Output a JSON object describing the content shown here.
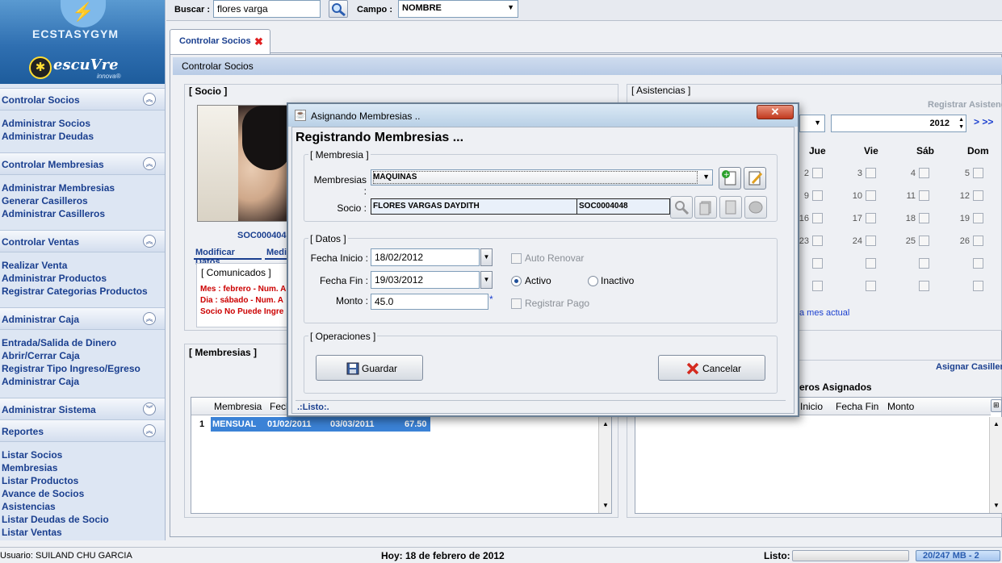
{
  "logo": {
    "brand_main": "ECSTASYGYM",
    "brand_sub": "escuVre",
    "brand_tag": "innova®"
  },
  "sidebar": {
    "sections": [
      {
        "title": "Controlar Socios",
        "collapsed": false,
        "items": [
          "Administrar Socios",
          "Administrar Deudas"
        ]
      },
      {
        "title": "Controlar Membresias",
        "collapsed": false,
        "items": [
          "Administrar Membresias",
          "Generar Casilleros",
          "Administrar Casilleros"
        ]
      },
      {
        "title": "Controlar Ventas",
        "collapsed": false,
        "items": [
          "Realizar Venta",
          "Administrar Productos",
          "Registrar Categorias Productos"
        ]
      },
      {
        "title": "Administrar Caja",
        "collapsed": false,
        "items": [
          "Entrada/Salida de Dinero",
          "Abrir/Cerrar Caja",
          "Registrar Tipo Ingreso/Egreso",
          "Administrar Caja"
        ]
      },
      {
        "title": "Administrar Sistema",
        "collapsed": true,
        "items": []
      },
      {
        "title": "Reportes",
        "collapsed": false,
        "items": [
          "Listar Socios",
          "Membresias",
          "Listar Productos",
          "Avance de Socios",
          "Asistencias",
          "Listar Deudas de Socio",
          "Listar Ventas"
        ]
      }
    ]
  },
  "search": {
    "label": "Buscar :",
    "value": "flores varga",
    "campo_label": "Campo :",
    "campo_value": "NOMBRE"
  },
  "tabs": [
    {
      "label": "Controlar Socios"
    }
  ],
  "breadcrumb": "Controlar Socios",
  "socio_panel": {
    "title": "[ Socio ]",
    "code_partial": "SOC000404",
    "btn_modificar": "Modificar Datos",
    "btn_medi": "Medi",
    "comunicados_title": "[ Comunicados ]",
    "comunicados": [
      "Mes : febrero - Num. A",
      "Dia : sábado - Num. A",
      "Socio No Puede Ingre"
    ]
  },
  "membresias_panel": {
    "title": "[ Membresias ]",
    "headers": [
      "Membresia",
      "Fech"
    ],
    "rows": [
      {
        "num": "1",
        "membresia": "MENSUAL",
        "inicio": "01/02/2011",
        "fin": "03/03/2011",
        "monto": "67.50"
      }
    ]
  },
  "asistencias_panel": {
    "title": "[ Asistencias ]",
    "registrar_label": "Registrar Asistenc",
    "year": "2012",
    "nav": "> >>",
    "days": [
      "Jue",
      "Vie",
      "Sáb",
      "Dom"
    ],
    "weeks": [
      [
        "2",
        "3",
        "4",
        "5"
      ],
      [
        "9",
        "10",
        "11",
        "12"
      ],
      [
        "16",
        "17",
        "18",
        "19"
      ],
      [
        "23",
        "24",
        "25",
        "26"
      ],
      [
        "",
        "",
        "",
        ""
      ],
      [
        "",
        "",
        "",
        ""
      ]
    ],
    "link": "a mes actual"
  },
  "casilleros_panel": {
    "asignar_label": "Asignar Casiller",
    "title": "eros Asignados",
    "headers": [
      "Inicio",
      "Fecha Fin",
      "Monto"
    ]
  },
  "dialog": {
    "window_title": "Asignando Membresias ..",
    "heading": "Registrando Membresias ...",
    "membresia_legend": "[ Membresia ]",
    "membresias_label": "Membresias :",
    "membresias_value": "MAQUINAS",
    "socio_label": "Socio :",
    "socio_name": "FLORES VARGAS DAYDITH",
    "socio_code": "SOC0004048",
    "datos_legend": "[ Datos ]",
    "fecha_inicio_label": "Fecha Inicio :",
    "fecha_inicio": "18/02/2012",
    "fecha_fin_label": "Fecha Fin :",
    "fecha_fin": "19/03/2012",
    "monto_label": "Monto :",
    "monto": "45.0",
    "monto_required": "*",
    "auto_renovar": "Auto Renovar",
    "activo": "Activo",
    "inactivo": "Inactivo",
    "registrar_pago": "Registrar Pago",
    "operaciones_legend": "[ Operaciones ]",
    "guardar": "Guardar",
    "cancelar": "Cancelar",
    "status": ".:Listo:."
  },
  "statusbar": {
    "user": "Usuario: SUILAND CHU GARCIA",
    "today": "Hoy: 18 de febrero de 2012",
    "listo": "Listo:",
    "memory": "20/247 MB - 2"
  },
  "colors": {
    "accent": "#1a3f8f",
    "comunicado_red": "#cc0000",
    "selected_row": "#3b82d6"
  }
}
